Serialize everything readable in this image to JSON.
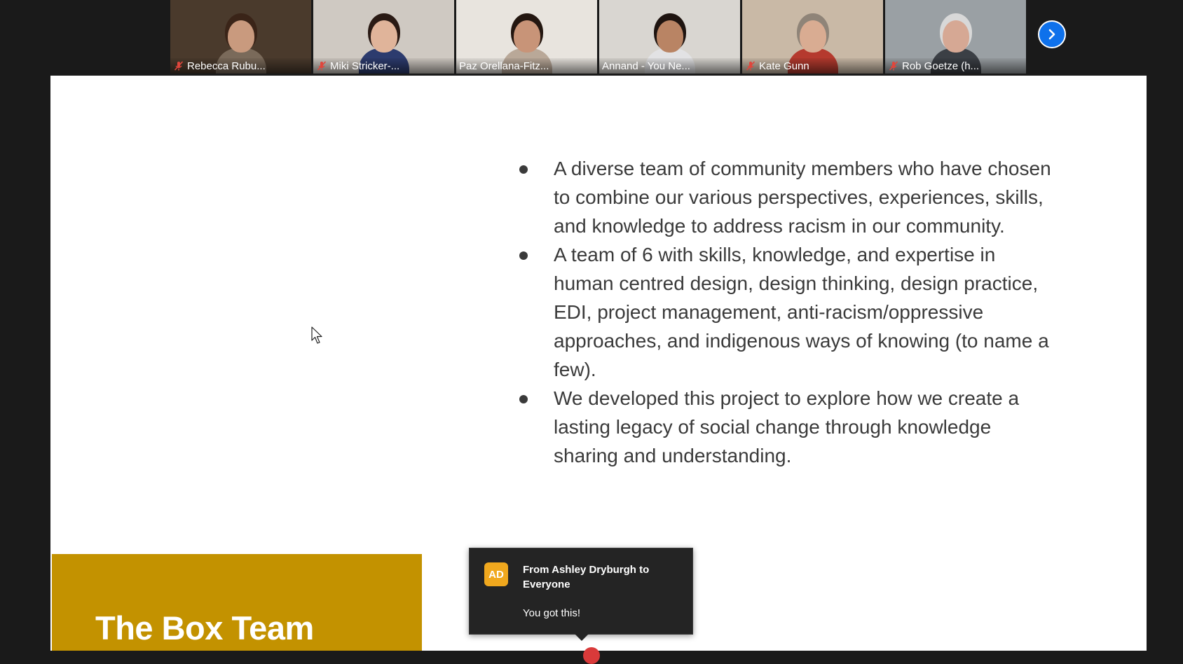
{
  "participants": [
    {
      "name": "Rebecca Rubu...",
      "muted": true,
      "active": false,
      "bg": "#4a3a2c",
      "skin": "#c99a7e",
      "hair": "#3a2418",
      "shirt": "#7a6a5a"
    },
    {
      "name": "Miki Stricker-...",
      "muted": true,
      "active": false,
      "bg": "#cfc9c2",
      "skin": "#e0b49a",
      "hair": "#2a1a14",
      "shirt": "#2c3b6e"
    },
    {
      "name": "Paz Orellana-Fitz...",
      "muted": false,
      "active": false,
      "bg": "#e8e4de",
      "skin": "#c89478",
      "hair": "#231610",
      "shirt": "#b9a898"
    },
    {
      "name": "Annand - You Ne...",
      "muted": false,
      "active": true,
      "bg": "#d9d6d1",
      "skin": "#b98464",
      "hair": "#1e1410",
      "shirt": "#e2e2e4"
    },
    {
      "name": "Kate Gunn",
      "muted": true,
      "active": false,
      "bg": "#c9b9a6",
      "skin": "#d9ac92",
      "hair": "#8f8478",
      "shirt": "#b53a2e"
    },
    {
      "name": "Rob Goetze (h...",
      "muted": true,
      "active": false,
      "bg": "#9aa0a4",
      "skin": "#d6a894",
      "hair": "#d8d8d8",
      "shirt": "#3b3f45"
    }
  ],
  "slide": {
    "bullets": [
      "A diverse team of community members who have chosen to combine our various perspectives, experiences, skills, and knowledge to address racism in our community.",
      "A team of 6 with skills, knowledge, and expertise in human centred design, design thinking, design practice, EDI, project management, anti-racism/oppressive approaches, and indigenous ways of knowing (to name a few).",
      "We developed this project to explore how we create a lasting legacy of social change through knowledge sharing and understanding."
    ],
    "title": "The Box Team",
    "accent": "#c39200"
  },
  "chat_toast": {
    "avatar": "AD",
    "from": "From Ashley Dryburgh to Everyone",
    "message": "You got this!"
  },
  "icons": {
    "mute": "muted-mic-icon",
    "next": "chevron-right-icon"
  }
}
